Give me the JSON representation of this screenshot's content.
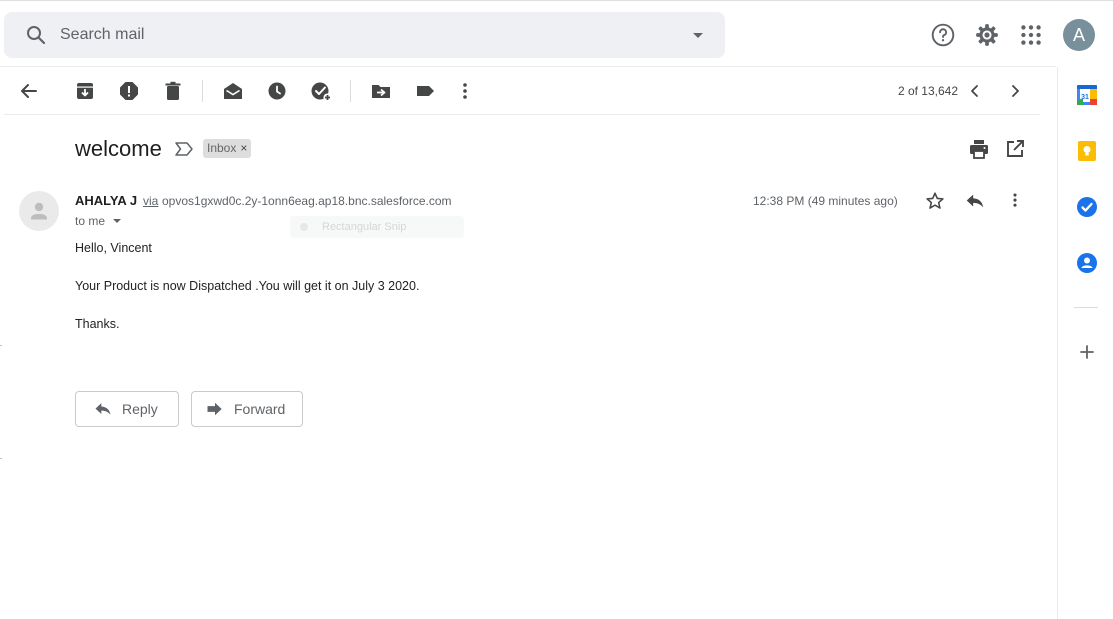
{
  "search": {
    "placeholder": "Search mail"
  },
  "header": {
    "icons": [
      "help-icon",
      "settings-icon",
      "apps-grid-icon"
    ],
    "avatar_letter": "A"
  },
  "toolbar": {
    "icons": [
      "back-arrow-icon",
      "archive-icon",
      "report-spam-icon",
      "delete-icon",
      "mark-unread-icon",
      "snooze-icon",
      "add-task-icon",
      "move-to-icon",
      "labels-icon",
      "more-vert-icon"
    ],
    "page_count": "2 of 13,642"
  },
  "email": {
    "subject": "welcome",
    "label_chip": "Inbox",
    "label_close": "×",
    "sender_name": "AHALYA J",
    "via": "via",
    "sender_address": "opvos1gxwd0c.2y-1onn6eag.ap18.bnc.salesforce.com",
    "recipient": "to me",
    "timestamp": "12:38 PM (49 minutes ago)",
    "ghost_tooltip": "Rectangular Snip",
    "body": [
      "Hello, Vincent",
      "Your Product is now Dispatched .You will get it on July 3 2020.",
      "Thanks."
    ]
  },
  "actions": {
    "reply_label": "Reply",
    "forward_label": "Forward"
  },
  "right_panel": {
    "apps": [
      "calendar-icon",
      "keep-icon",
      "tasks-icon",
      "contacts-icon",
      "add-addon-icon"
    ],
    "calendar_day": "31"
  },
  "colors": {
    "search_bg": "#eef0f3",
    "avatar_bg": "#78909c",
    "keep_yellow": "#fbbc04",
    "tasks_blue": "#1a73e8",
    "calendar_blue": "#4285f4"
  }
}
